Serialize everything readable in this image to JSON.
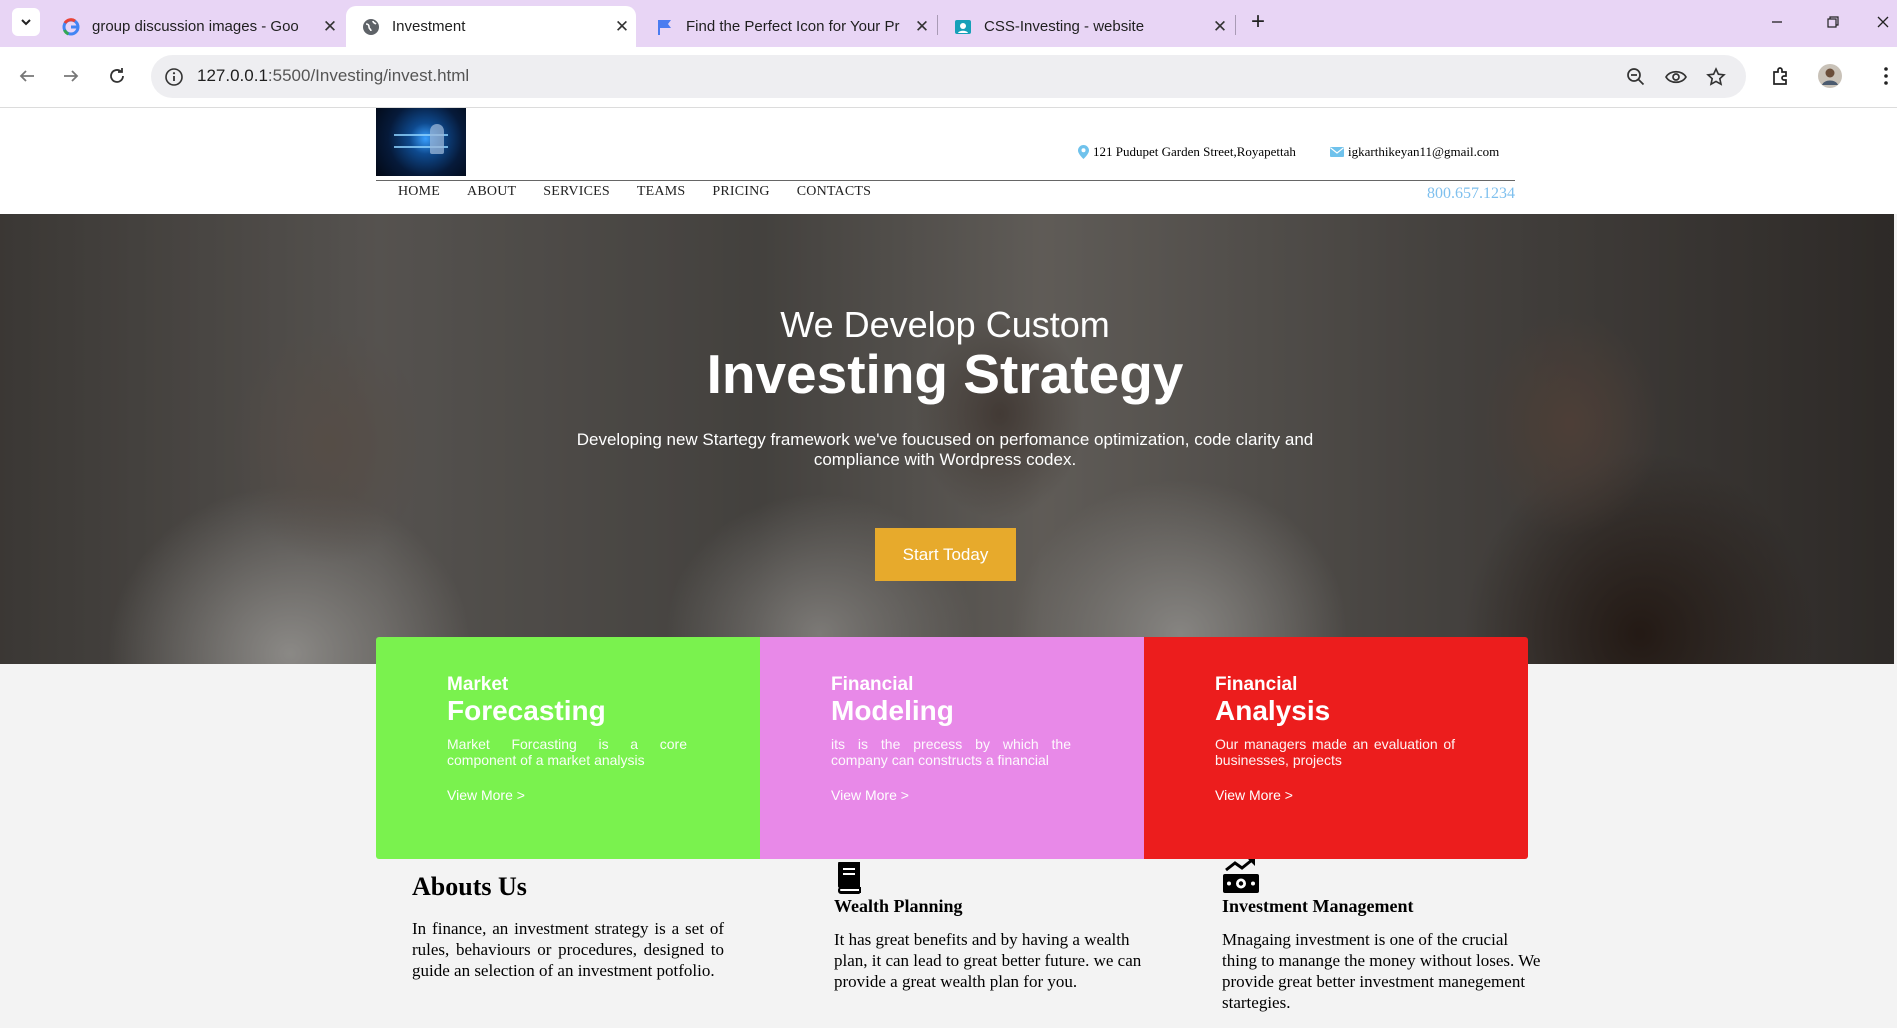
{
  "browser": {
    "tabs": [
      {
        "title": "group discussion images - Goo",
        "icon": "google-icon"
      },
      {
        "title": "Investment",
        "icon": "globe-icon",
        "active": true
      },
      {
        "title": "Find the Perfect Icon for Your Pr",
        "icon": "flag-icon"
      },
      {
        "title": "CSS-Investing - website",
        "icon": "contact-card-icon"
      }
    ],
    "url_host": "127.0.0.1",
    "url_rest": ":5500/Investing/invest.html"
  },
  "site": {
    "address": "121 Pudupet Garden Street,Royapettah",
    "email": "igkarthikeyan11@gmail.com",
    "phone": "800.657.1234",
    "menu": [
      "HOME",
      "ABOUT",
      "SERVICES",
      "TEAMS",
      "PRICING",
      "CONTACTS"
    ]
  },
  "hero": {
    "subtitle": "We Develop Custom",
    "title": "Investing Strategy",
    "description": "Developing new Startegy framework we've foucused on perfomance optimization, code clarity and compliance with Wordpress codex.",
    "button": "Start Today"
  },
  "cards": [
    {
      "kicker": "Market",
      "title": "Forecasting",
      "text": "Market Forcasting is a core component of a market analysis",
      "link": "View More >",
      "color": "#7af24e"
    },
    {
      "kicker": "Financial",
      "title": "Modeling",
      "text": "its is the precess by which the company can constructs a financial",
      "link": "View More >",
      "color": "#e889e8"
    },
    {
      "kicker": "Financial",
      "title": "Analysis",
      "text": "Our managers made an evaluation of businesses, projects",
      "link": "View More >",
      "color": "#ec1d1d"
    }
  ],
  "about": {
    "heading": "Abouts Us",
    "text": "In finance, an investment strategy is a set of rules, behaviours or procedures, designed to guide an selection of an investment potfolio."
  },
  "wealth": {
    "icon": "book-icon",
    "heading": "Wealth Planning",
    "text": "It has great benefits and by having a wealth plan, it can lead to great better future. we can provide a great wealth plan for you."
  },
  "invest": {
    "icon": "money-growth-icon",
    "heading": "Investment Management",
    "text": "Mnagaing investment is one of the crucial thing to manange the money without loses. We provide great better investment manegement startegies."
  },
  "colors": {
    "accent_button": "#e7aa2c",
    "phone": "#7fc0ee",
    "tab_strip": "#e8d5f5"
  }
}
